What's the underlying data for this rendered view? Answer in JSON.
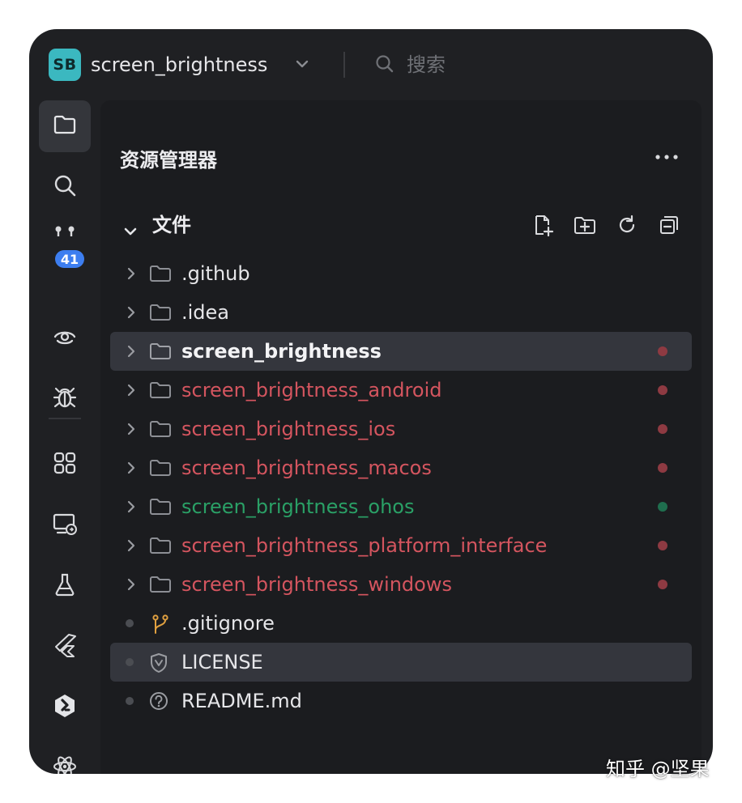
{
  "app": {
    "badge": "SB",
    "project_name": "screen_brightness",
    "search_label": "搜索"
  },
  "activity_bar": {
    "items": [
      {
        "icon": "folder-icon",
        "active": true
      },
      {
        "icon": "search-icon"
      },
      {
        "icon": "source-control-icon",
        "badge": "41"
      },
      {
        "icon": "eye-icon"
      },
      {
        "icon": "bug-icon"
      },
      {
        "icon": "extensions-icon"
      },
      {
        "icon": "remote-device-icon"
      },
      {
        "icon": "flask-icon"
      },
      {
        "icon": "flutter-icon"
      },
      {
        "icon": "harmony-icon"
      },
      {
        "icon": "atom-icon"
      }
    ]
  },
  "explorer": {
    "title": "资源管理器",
    "more": "...",
    "section_title": "文件",
    "actions": [
      "new-file-icon",
      "new-folder-icon",
      "refresh-icon",
      "collapse-all-icon"
    ],
    "tree": [
      {
        "label": ".github",
        "type": "folder",
        "style": "normal",
        "status": null
      },
      {
        "label": ".idea",
        "type": "folder",
        "style": "normal",
        "status": null
      },
      {
        "label": "screen_brightness",
        "type": "folder",
        "style": "bold",
        "status": "modified",
        "selected": true
      },
      {
        "label": "screen_brightness_android",
        "type": "folder",
        "style": "red",
        "status": "modified"
      },
      {
        "label": "screen_brightness_ios",
        "type": "folder",
        "style": "red",
        "status": "modified"
      },
      {
        "label": "screen_brightness_macos",
        "type": "folder",
        "style": "red",
        "status": "modified"
      },
      {
        "label": "screen_brightness_ohos",
        "type": "folder",
        "style": "green",
        "status": "added"
      },
      {
        "label": "screen_brightness_platform_interface",
        "type": "folder",
        "style": "red",
        "status": "modified"
      },
      {
        "label": "screen_brightness_windows",
        "type": "folder",
        "style": "red",
        "status": "modified"
      },
      {
        "label": ".gitignore",
        "type": "git-file",
        "style": "normal",
        "status": null
      },
      {
        "label": "LICENSE",
        "type": "license-file",
        "style": "normal",
        "status": null,
        "selected": true
      },
      {
        "label": "README.md",
        "type": "readme-file",
        "style": "normal",
        "status": null
      }
    ]
  },
  "colors": {
    "modified": "#8e3a42",
    "added": "#1f6e4e",
    "accent_badge": "#3d7ef0",
    "app_badge": "#3bb8c0"
  },
  "watermark": "知乎 @坚果"
}
